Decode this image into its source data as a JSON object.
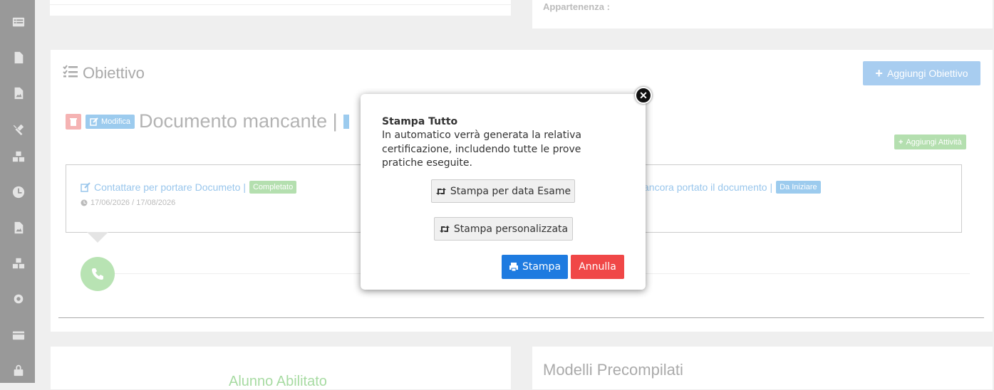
{
  "top": {
    "appartenenza_label": "Appartenenza :"
  },
  "obiettivo": {
    "title": "Obiettivo",
    "add_button": "Aggiungi Obiettivo",
    "modifica_label": "Modifica",
    "doc_title": "Documento mancante |",
    "add_activity": "Aggiungi Attività",
    "tasks": [
      {
        "label": "Contattare per portare Documeto |",
        "status": "Completato",
        "date": "17/06/2026 / 17/08/2026"
      },
      {
        "label": "ancora portato il documento |",
        "status": "Da Iniziare"
      }
    ]
  },
  "bottom": {
    "left_title": "Alunno Abilitato",
    "right_title": "Modelli Precompilati"
  },
  "modal": {
    "title": "Stampa Tutto",
    "text": "In automatico verrà generata la relativa certificazione, includendo tutte le prove pratiche eseguite.",
    "option1": "Stampa per data Esame",
    "option2": "Stampa personalizzata",
    "stampa": "Stampa",
    "annulla": "Annulla"
  },
  "colors": {
    "primary": "#1e7be0",
    "danger": "#f04747",
    "success_light": "#b4dfaf",
    "info_light": "#9ccbee"
  }
}
